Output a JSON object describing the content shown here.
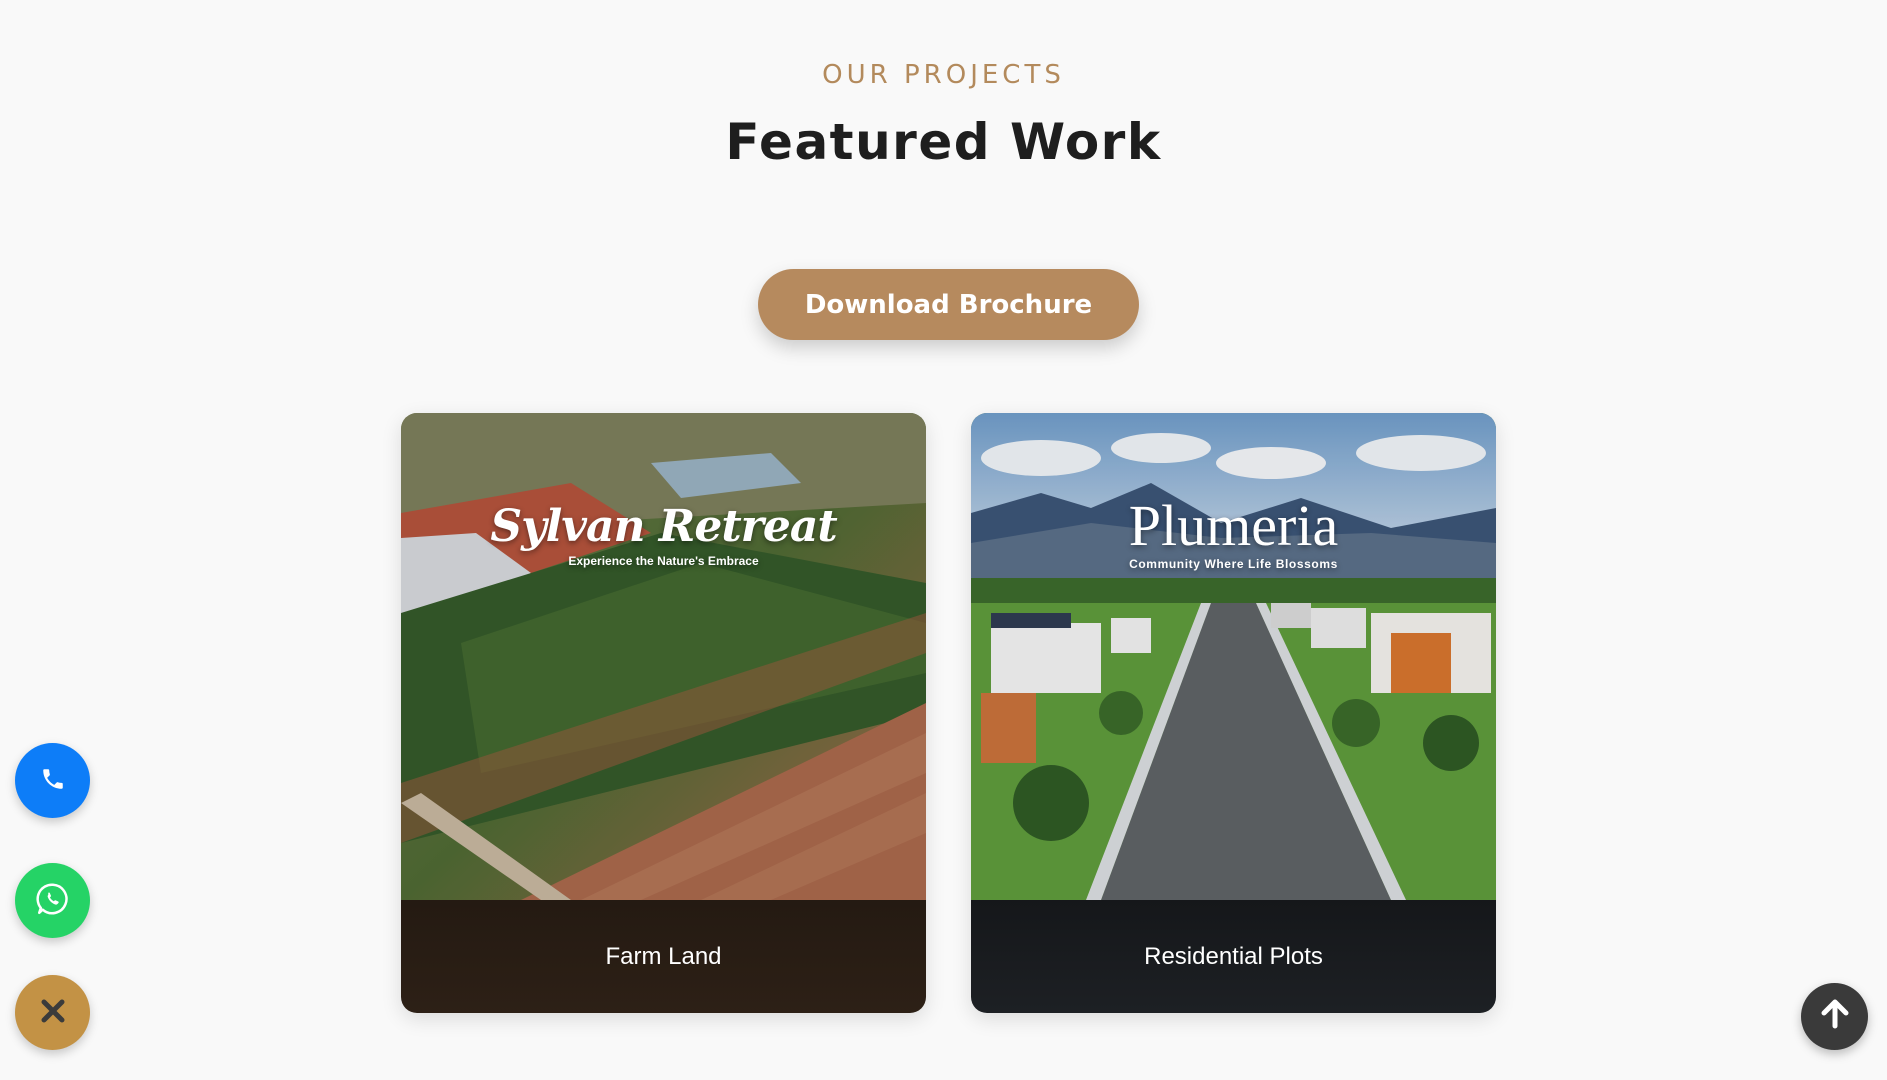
{
  "section": {
    "eyebrow": "OUR PROJECTS",
    "title": "Featured Work",
    "brochure_label": "Download Brochure"
  },
  "projects": [
    {
      "logo_name": "Sylvan Retreat",
      "logo_tagline": "Experience the Nature's Embrace",
      "caption": "Farm Land"
    },
    {
      "logo_name": "Plumeria",
      "logo_tagline": "Community Where Life Blossoms",
      "caption": "Residential Plots"
    }
  ],
  "floating_buttons": {
    "phone_icon": "phone-icon",
    "whatsapp_icon": "whatsapp-icon",
    "close_icon": "close-icon",
    "scroll_top_icon": "arrow-up-icon"
  },
  "colors": {
    "accent": "#b68a5e",
    "phone": "#0d7df8",
    "whatsapp": "#25d366",
    "close": "#c39245",
    "scroll_top": "#3a3a3a"
  }
}
